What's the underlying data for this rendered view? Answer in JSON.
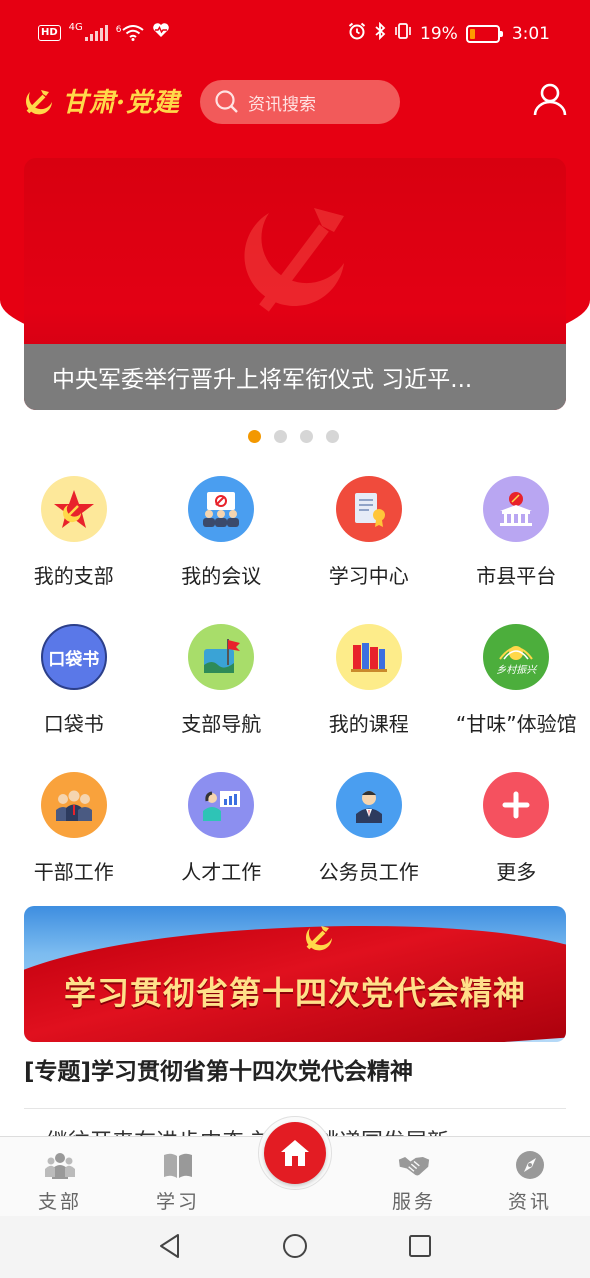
{
  "status_bar": {
    "network": "HD",
    "network_type": "4G",
    "wifi": "6",
    "battery": "19%",
    "battery_fraction": 0.19,
    "time": "3:01"
  },
  "header": {
    "logo_text": "甘肃·党建",
    "search_placeholder": "资讯搜索",
    "bg_color": "#e60012"
  },
  "banner": {
    "caption": "中央军委举行晋升上将军衔仪式 习近平...",
    "slide_count": 4,
    "active_slide": 1
  },
  "grid": [
    {
      "label": "我的支部",
      "icon": "party-star-icon",
      "color": "#fde89a"
    },
    {
      "label": "我的会议",
      "icon": "meeting-icon",
      "color": "#4a9ef0"
    },
    {
      "label": "学习中心",
      "icon": "study-center-icon",
      "color": "#f04b3c"
    },
    {
      "label": "市县平台",
      "icon": "government-building-icon",
      "color": "#b9a6f2"
    },
    {
      "label": "口袋书",
      "icon": "pocket-book-icon",
      "color": "#5a78e8"
    },
    {
      "label": "支部导航",
      "icon": "navigation-flag-icon",
      "color": "#a8dd6a"
    },
    {
      "label": "我的课程",
      "icon": "books-icon",
      "color": "#fdec8a"
    },
    {
      "label": "“甘味”体验馆",
      "icon": "rural-revitalization-icon",
      "color": "#4cae3c"
    },
    {
      "label": "干部工作",
      "icon": "cadres-icon",
      "color": "#f9a23c"
    },
    {
      "label": "人才工作",
      "icon": "talent-presentation-icon",
      "color": "#8c8ff0"
    },
    {
      "label": "公务员工作",
      "icon": "civil-servant-icon",
      "color": "#4a9ef0"
    },
    {
      "label": "更多",
      "icon": "plus-icon",
      "color": "#f5515f"
    }
  ],
  "grid_icon_text": {
    "pocket_book": "口袋书",
    "rural": "乡村振兴"
  },
  "promo": {
    "title": "学习贯彻省第十四次党代会精神"
  },
  "topic": {
    "title": "[专题]学习贯彻省第十四次党代会精神",
    "next_item_preview": "继往开来在进步中奋 前国党跳递国发展新"
  },
  "tabbar": {
    "items": [
      {
        "label": "支部",
        "icon": "branch-people-icon"
      },
      {
        "label": "学习",
        "icon": "open-book-icon"
      },
      {
        "label": "服务",
        "icon": "handshake-icon"
      },
      {
        "label": "资讯",
        "icon": "compass-icon"
      }
    ],
    "home_icon": "home-icon"
  }
}
